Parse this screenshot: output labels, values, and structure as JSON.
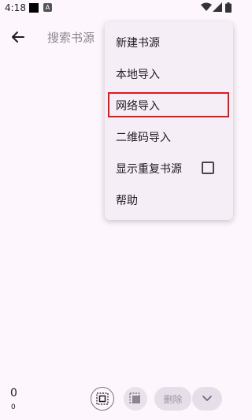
{
  "status_bar": {
    "time": "4:18",
    "notification_icon": "A"
  },
  "toolbar": {
    "back_icon": "arrow-left-icon",
    "search_placeholder": "搜索书源"
  },
  "menu": {
    "items": [
      {
        "label": "新建书源"
      },
      {
        "label": "本地导入"
      },
      {
        "label": "网络导入",
        "highlighted": true
      },
      {
        "label": "二维码导入"
      },
      {
        "label": "显示重复书源",
        "checkbox": true,
        "checked": false
      },
      {
        "label": "帮助"
      }
    ]
  },
  "bottom_bar": {
    "count": "0",
    "count_sub": "0",
    "delete_label": "删除",
    "select_all_icon": "select-all-icon",
    "select_inverse_icon": "select-inverse-icon",
    "more_icon": "chevron-down-icon"
  },
  "colors": {
    "highlight": "#e4161c",
    "background": "#fdf6fc",
    "menu_background": "#f6eef6"
  }
}
